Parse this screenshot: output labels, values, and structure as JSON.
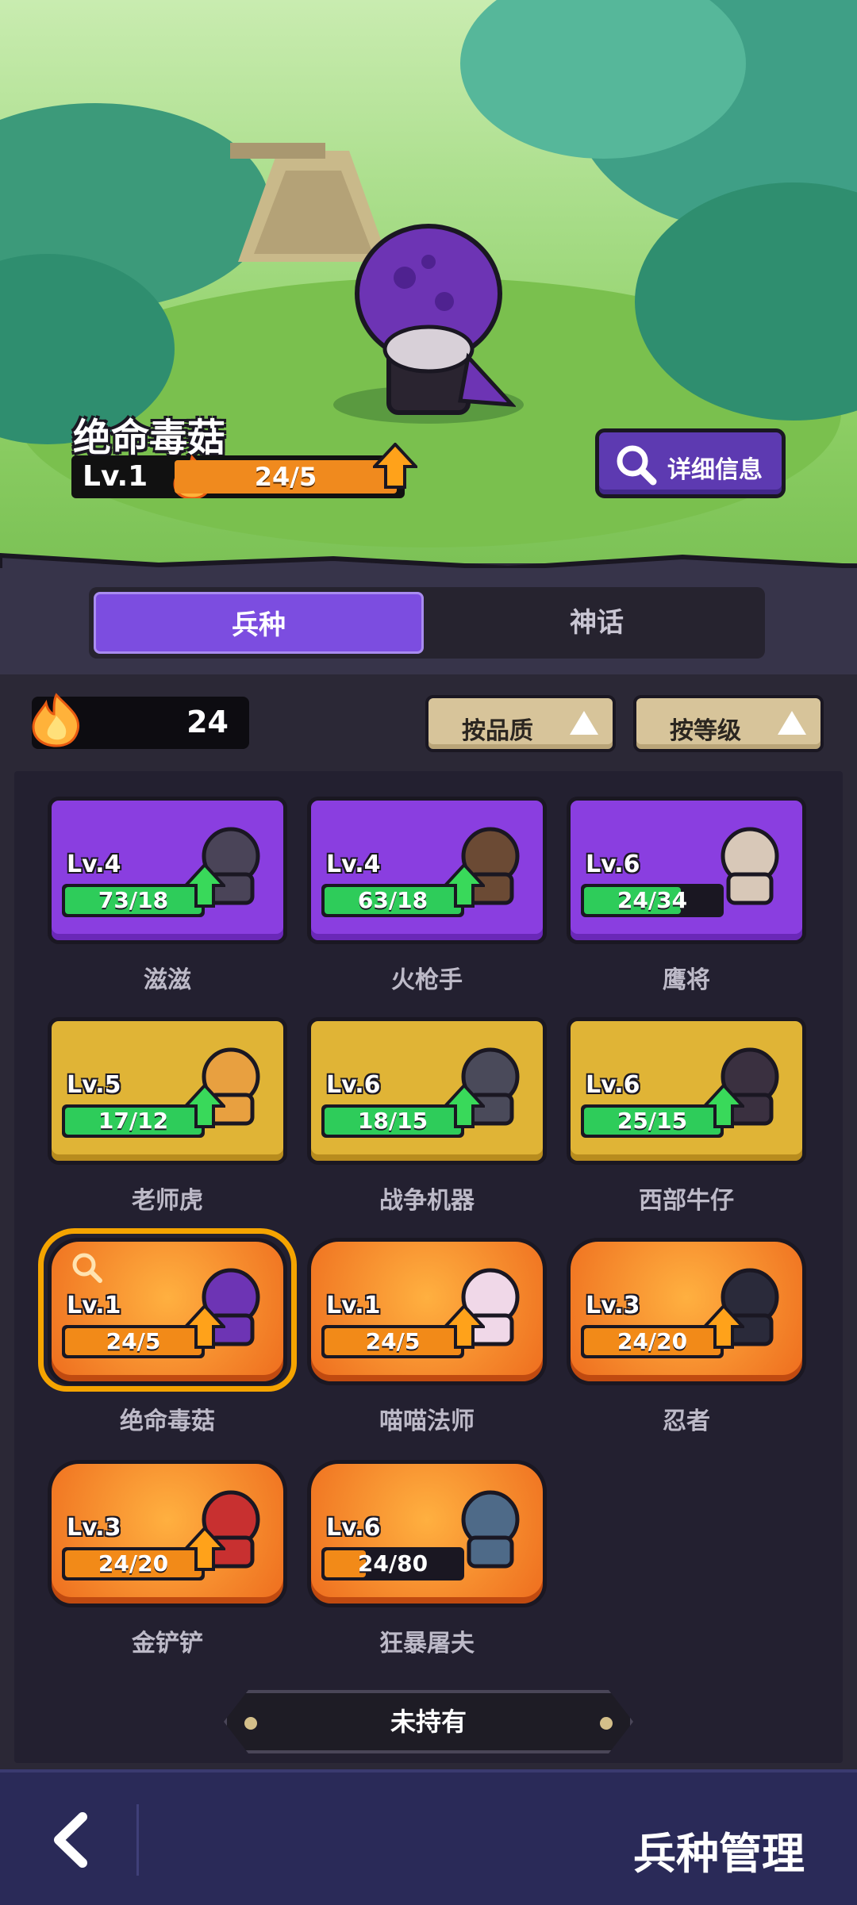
{
  "hero": {
    "name": "绝命毒菇",
    "level": "Lv.1",
    "progress": "24/5",
    "detail_button": "详细信息"
  },
  "tabs": [
    "兵种",
    "神话"
  ],
  "resource": {
    "icon": "fire-icon",
    "value": "24"
  },
  "sort_buttons": [
    "按品质",
    "按等级"
  ],
  "units": [
    {
      "name": "滋滋",
      "level": "Lv.4",
      "progress": "73/18",
      "fill": 1.0,
      "rarity": "purple",
      "upgradable": true
    },
    {
      "name": "火枪手",
      "level": "Lv.4",
      "progress": "63/18",
      "fill": 1.0,
      "rarity": "purple",
      "upgradable": true
    },
    {
      "name": "鹰将",
      "level": "Lv.6",
      "progress": "24/34",
      "fill": 0.71,
      "rarity": "purple",
      "upgradable": false
    },
    {
      "name": "老师虎",
      "level": "Lv.5",
      "progress": "17/12",
      "fill": 1.0,
      "rarity": "gold",
      "upgradable": true
    },
    {
      "name": "战争机器",
      "level": "Lv.6",
      "progress": "18/15",
      "fill": 1.0,
      "rarity": "gold",
      "upgradable": true
    },
    {
      "name": "西部牛仔",
      "level": "Lv.6",
      "progress": "25/15",
      "fill": 1.0,
      "rarity": "gold",
      "upgradable": true
    },
    {
      "name": "绝命毒菇",
      "level": "Lv.1",
      "progress": "24/5",
      "fill": 1.0,
      "rarity": "orange",
      "upgradable": true
    },
    {
      "name": "喵喵法师",
      "level": "Lv.1",
      "progress": "24/5",
      "fill": 1.0,
      "rarity": "orange",
      "upgradable": true
    },
    {
      "name": "忍者",
      "level": "Lv.3",
      "progress": "24/20",
      "fill": 1.0,
      "rarity": "orange",
      "upgradable": true
    },
    {
      "name": "金铲铲",
      "level": "Lv.3",
      "progress": "24/20",
      "fill": 1.0,
      "rarity": "orange",
      "upgradable": true
    },
    {
      "name": "狂暴屠夫",
      "level": "Lv.6",
      "progress": "24/80",
      "fill": 0.3,
      "rarity": "orange",
      "upgradable": false
    }
  ],
  "not_owned_label": "未持有",
  "footer": {
    "back_icon": "chevron-left-icon",
    "title": "兵种管理"
  }
}
